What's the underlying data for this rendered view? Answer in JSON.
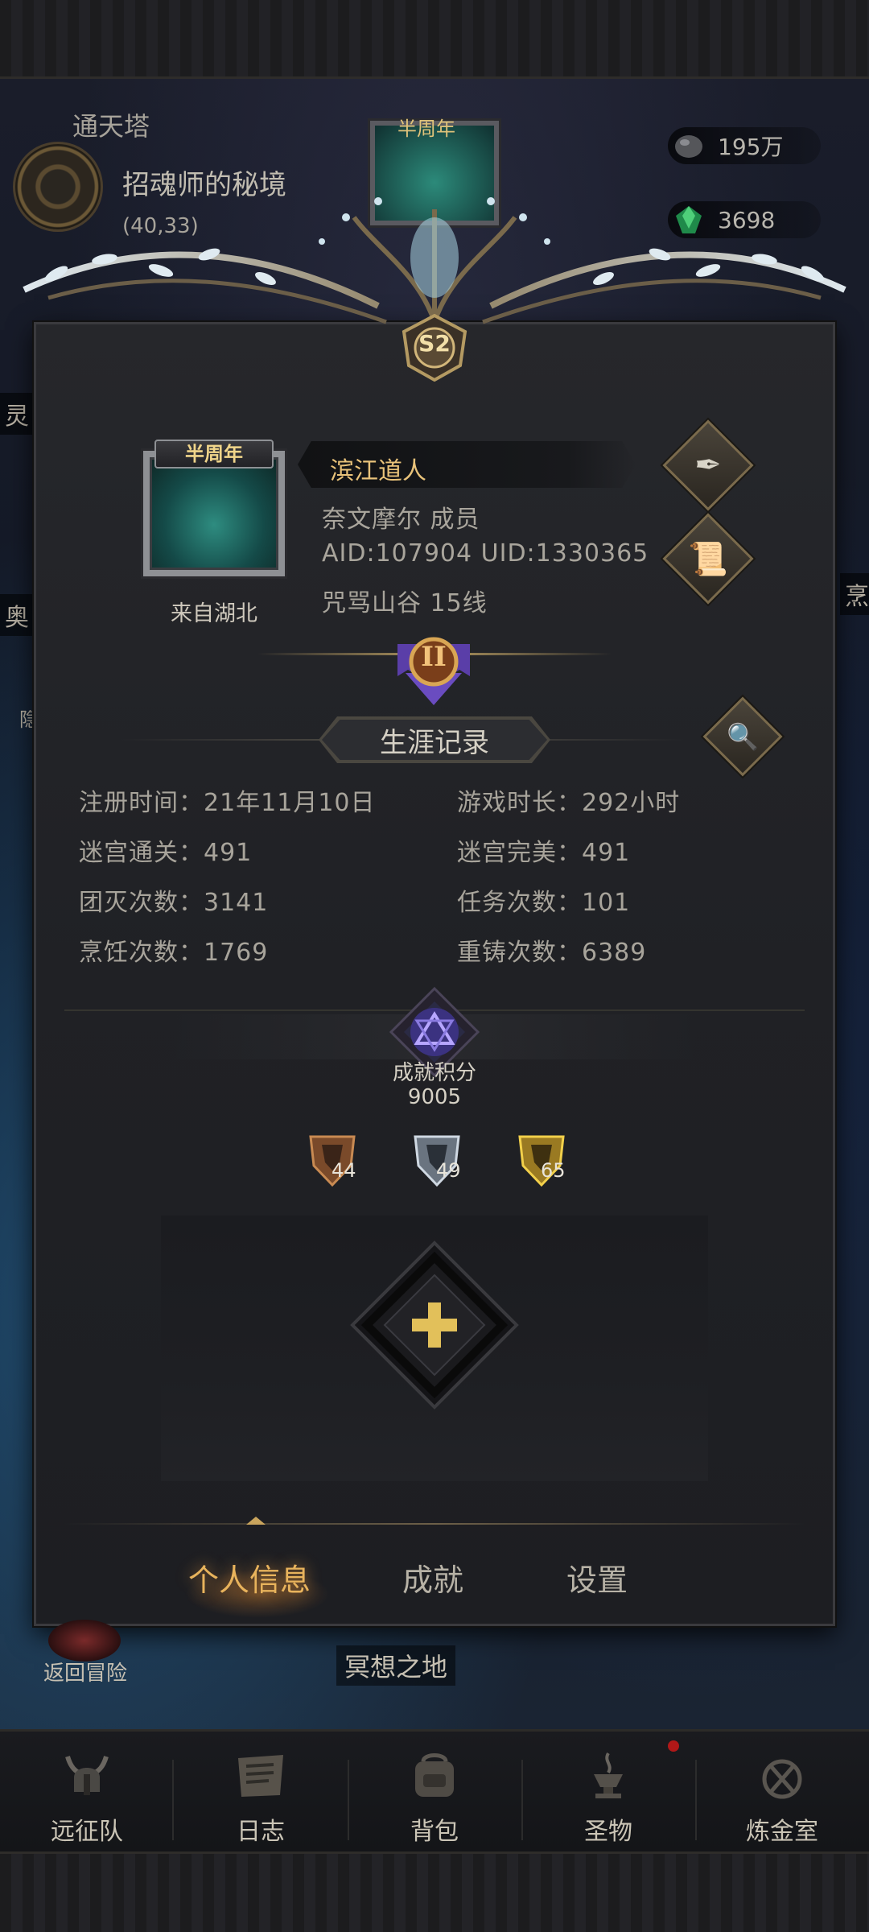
{
  "background": {
    "location_title": "通天塔",
    "dungeon_name": "招魂师的秘境",
    "coords": "(40,33)",
    "map_tag": "半周年",
    "resources": [
      {
        "icon": "stone-icon",
        "value": "195万"
      },
      {
        "icon": "emerald-icon",
        "value": "3698"
      }
    ],
    "side_labels": [
      "灵",
      "奥",
      "隐",
      "烹"
    ]
  },
  "panel": {
    "season_badge": "S2",
    "avatar_tag": "半周年",
    "from_region": "来自湖北",
    "player_name": "滨江道人",
    "guild_line": "奈文摩尔  成员",
    "ids_line": "AID:107904 UID:1330365",
    "server_line": "咒骂山谷  15线",
    "rank_numeral": "II",
    "section_title": "生涯记录",
    "stats": [
      {
        "label": "注册时间：",
        "value": "21年11月10日"
      },
      {
        "label": "游戏时长：",
        "value": "292小时"
      },
      {
        "label": "迷宫通关：",
        "value": "491"
      },
      {
        "label": "迷宫完美：",
        "value": "491"
      },
      {
        "label": "团灭次数：",
        "value": "3141"
      },
      {
        "label": "任务次数：",
        "value": "101"
      },
      {
        "label": "烹饪次数：",
        "value": "1769"
      },
      {
        "label": "重铸次数：",
        "value": "6389"
      }
    ],
    "achievement": {
      "label": "成就积分",
      "score": "9005",
      "medals": [
        {
          "tier": "bronze",
          "count": "44"
        },
        {
          "tier": "silver",
          "count": "49"
        },
        {
          "tier": "gold",
          "count": "65"
        }
      ]
    },
    "tabs": [
      "个人信息",
      "成就",
      "设置"
    ],
    "active_tab": "个人信息"
  },
  "below_panel": {
    "return_label": "返回冒险",
    "meditation_label": "冥想之地"
  },
  "nav": [
    {
      "icon": "viking-helmet-icon",
      "label": "远征队"
    },
    {
      "icon": "journal-icon",
      "label": "日志"
    },
    {
      "icon": "backpack-icon",
      "label": "背包"
    },
    {
      "icon": "relic-icon",
      "label": "圣物"
    },
    {
      "icon": "alchemy-icon",
      "label": "炼金室"
    }
  ],
  "colors": {
    "accent_gold": "#e8b35c",
    "name_gold": "#e9c37a",
    "panel_bg": "#222327",
    "notification_red": "#b01818"
  }
}
